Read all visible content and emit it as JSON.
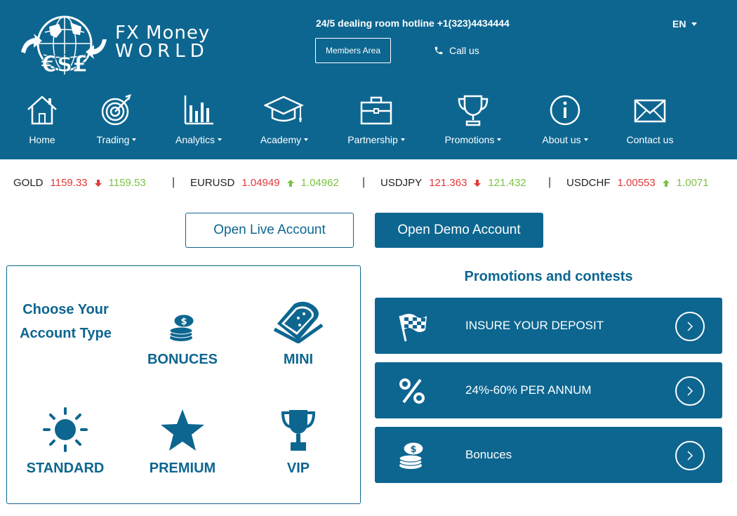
{
  "brand": {
    "line1": "FX Money",
    "line2": "World"
  },
  "header": {
    "hotline": "24/5 dealing room hotline +1(323)4434444",
    "members_label": "Members Area",
    "call_label": "Call us",
    "lang": "EN"
  },
  "nav": [
    {
      "label": "Home",
      "icon": "house-icon",
      "dropdown": false
    },
    {
      "label": "Trading",
      "icon": "target-icon",
      "dropdown": true
    },
    {
      "label": "Analytics",
      "icon": "bar-chart-icon",
      "dropdown": true
    },
    {
      "label": "Academy",
      "icon": "graduation-cap-icon",
      "dropdown": true
    },
    {
      "label": "Partnership",
      "icon": "briefcase-icon",
      "dropdown": true
    },
    {
      "label": "Promotions",
      "icon": "trophy-icon",
      "dropdown": true
    },
    {
      "label": "About us",
      "icon": "info-icon",
      "dropdown": true
    },
    {
      "label": "Contact us",
      "icon": "envelope-icon",
      "dropdown": false
    }
  ],
  "ticker": [
    {
      "symbol": "GOLD",
      "bid": "1159.33",
      "ask": "1159.53",
      "trend": "down"
    },
    {
      "symbol": "EURUSD",
      "bid": "1.04949",
      "ask": "1.04962",
      "trend": "up"
    },
    {
      "symbol": "USDJPY",
      "bid": "121.363",
      "ask": "121.432",
      "trend": "down"
    },
    {
      "symbol": "USDCHF",
      "bid": "1.00553",
      "ask": "1.0071",
      "trend": "up"
    }
  ],
  "ticker_separator": "|",
  "actions": {
    "live": "Open Live Account",
    "demo": "Open Demo Account"
  },
  "accounts": {
    "title": "Choose Your Account Type",
    "items": [
      {
        "label": "BONUCES",
        "icon": "coin-stack-icon"
      },
      {
        "label": "MINI",
        "icon": "bread-slice-icon"
      },
      {
        "label": "STANDARD",
        "icon": "sun-icon"
      },
      {
        "label": "PREMIUM",
        "icon": "star-icon"
      },
      {
        "label": "VIP",
        "icon": "trophy-icon"
      }
    ]
  },
  "promotions": {
    "title": "Promotions and contests",
    "items": [
      {
        "label": "INSURE YOUR DEPOSIT",
        "icon": "checkered-flag-icon"
      },
      {
        "label": "24%-60% PER ANNUM",
        "icon": "percent-icon"
      },
      {
        "label": "Bonuces",
        "icon": "coin-stack-icon"
      }
    ]
  },
  "colors": {
    "primary": "#0d6690",
    "price_down": "#e03a3a",
    "price_up": "#7cc242"
  }
}
